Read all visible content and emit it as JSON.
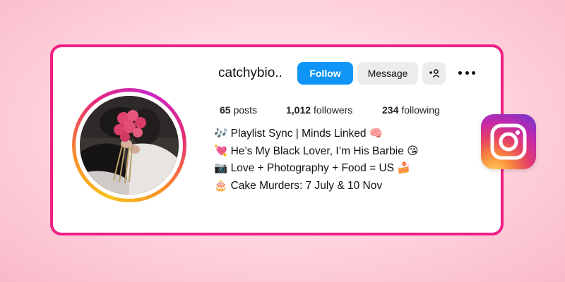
{
  "profile": {
    "username": "catchybio..",
    "follow_label": "Follow",
    "message_label": "Message",
    "add_user_icon": "add-user-icon",
    "more_icon": "more-options-icon",
    "stats": {
      "posts_count": "65",
      "posts_label": "posts",
      "followers_count": "1,012",
      "followers_label": "followers",
      "following_count": "234",
      "following_label": "following"
    },
    "bio": [
      "🎶 Playlist Sync | Minds Linked 🧠",
      "💘 He’s My Black Lover, I’m His Barbie 😘",
      "📷 Love + Photography + Food = US 🍰",
      "🎂 Cake Murders: 7 July & 10 Nov"
    ]
  },
  "colors": {
    "card_border": "#ee1f85",
    "follow_button": "#0e95f5",
    "secondary_button": "#ececec"
  },
  "logo": "instagram-logo-icon"
}
